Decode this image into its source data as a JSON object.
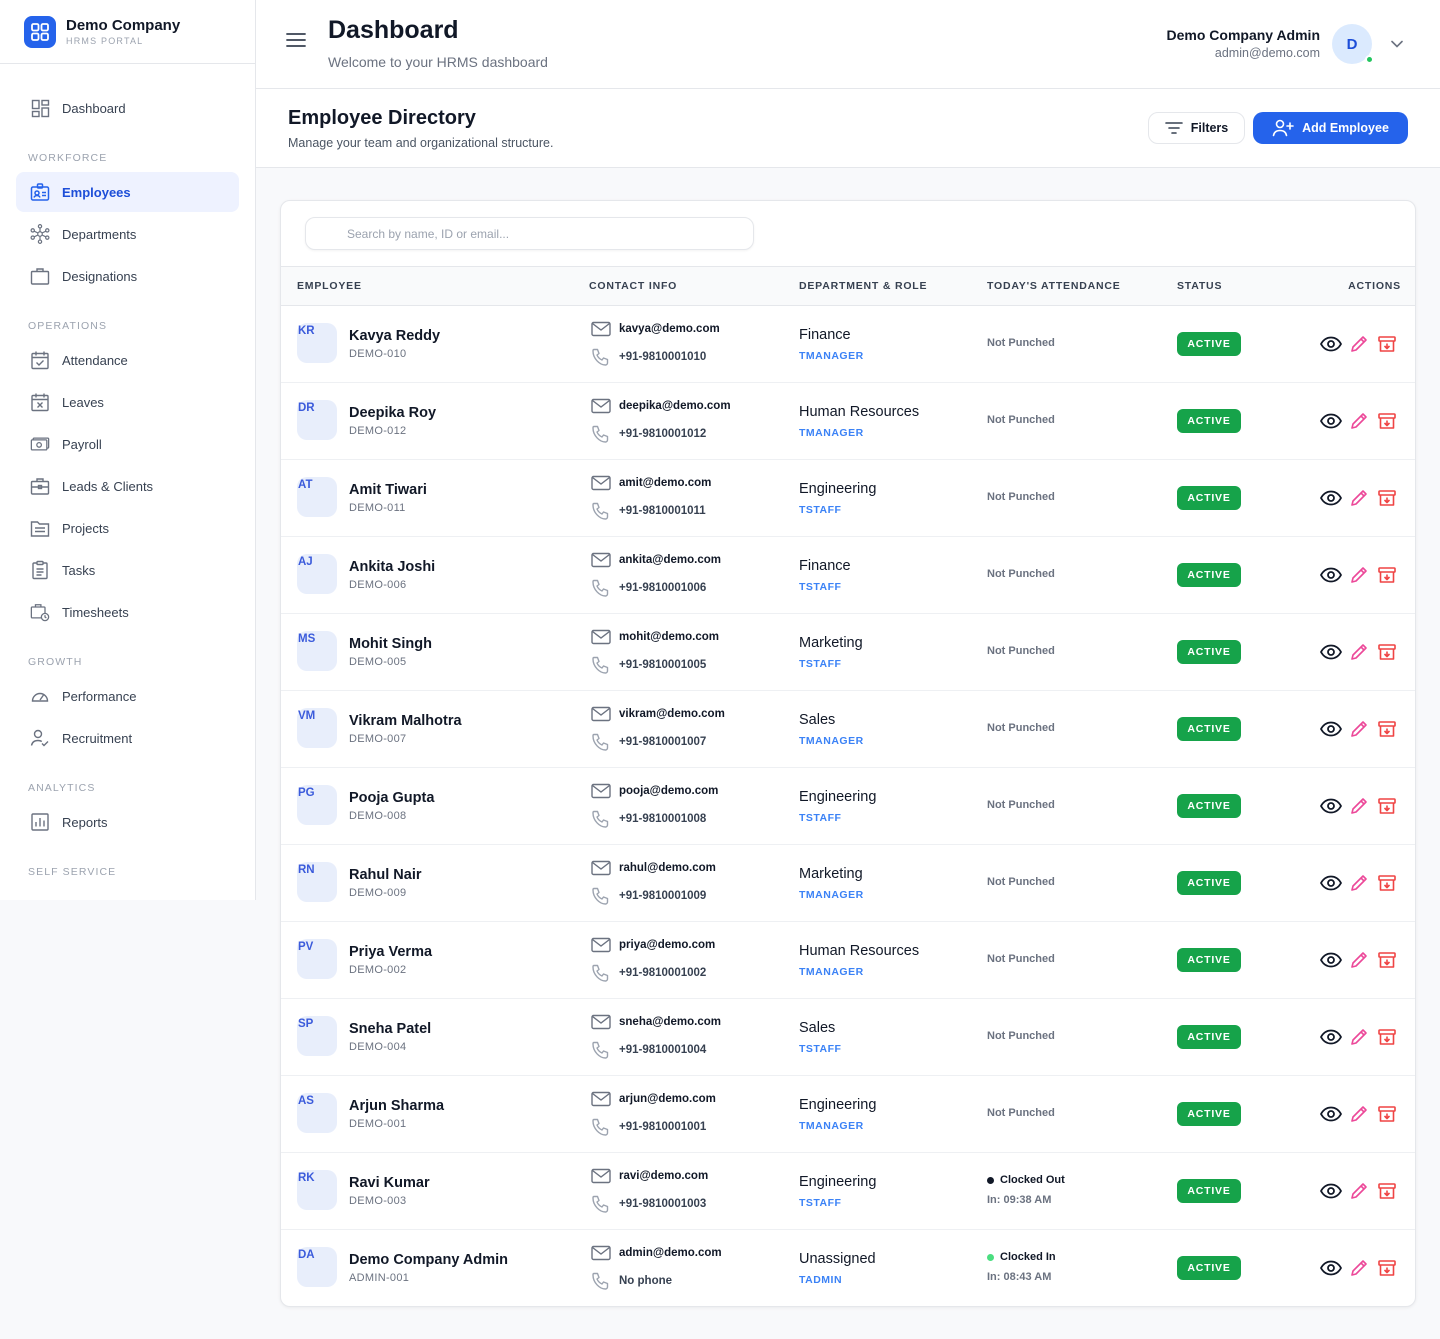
{
  "brand": {
    "name": "Demo Company",
    "sub": "HRMS PORTAL"
  },
  "nav": {
    "dashboard": "Dashboard",
    "sections": {
      "workforce": "WORKFORCE",
      "operations": "OPERATIONS",
      "growth": "GROWTH",
      "analytics": "ANALYTICS",
      "self_service": "SELF SERVICE"
    },
    "items": {
      "employees": "Employees",
      "departments": "Departments",
      "designations": "Designations",
      "attendance": "Attendance",
      "leaves": "Leaves",
      "payroll": "Payroll",
      "leads": "Leads & Clients",
      "projects": "Projects",
      "tasks": "Tasks",
      "timesheets": "Timesheets",
      "performance": "Performance",
      "recruitment": "Recruitment",
      "reports": "Reports"
    },
    "active": "employees"
  },
  "header": {
    "title": "Dashboard",
    "subtitle": "Welcome to your HRMS dashboard",
    "user_name": "Demo Company Admin",
    "user_email": "admin@demo.com",
    "avatar_initial": "D"
  },
  "directory": {
    "title": "Employee Directory",
    "subtitle": "Manage your team and organizational structure.",
    "filters_label": "Filters",
    "add_label": "Add Employee",
    "search_placeholder": "Search by name, ID or email...",
    "columns": {
      "employee": "EMPLOYEE",
      "contact": "CONTACT INFO",
      "dept_role": "DEPARTMENT & ROLE",
      "attendance": "TODAY'S ATTENDANCE",
      "status": "STATUS",
      "actions": "ACTIONS"
    }
  },
  "colors": {
    "accent": "#2563eb",
    "active_status": "#16a34a",
    "edit_icon": "#ec4899",
    "archive_icon": "#ef4444",
    "clocked_out_dot": "#111827",
    "clocked_in_dot": "#4ade80"
  },
  "employees": [
    {
      "initials": "KR",
      "name": "Kavya Reddy",
      "id": "DEMO-010",
      "email": "kavya@demo.com",
      "phone": "+91-9810001010",
      "dept": "Finance",
      "role": "TMANAGER",
      "attendance": "Not Punched",
      "attendance_time": "",
      "status": "ACTIVE"
    },
    {
      "initials": "DR",
      "name": "Deepika Roy",
      "id": "DEMO-012",
      "email": "deepika@demo.com",
      "phone": "+91-9810001012",
      "dept": "Human Resources",
      "role": "TMANAGER",
      "attendance": "Not Punched",
      "attendance_time": "",
      "status": "ACTIVE"
    },
    {
      "initials": "AT",
      "name": "Amit Tiwari",
      "id": "DEMO-011",
      "email": "amit@demo.com",
      "phone": "+91-9810001011",
      "dept": "Engineering",
      "role": "TSTAFF",
      "attendance": "Not Punched",
      "attendance_time": "",
      "status": "ACTIVE"
    },
    {
      "initials": "AJ",
      "name": "Ankita Joshi",
      "id": "DEMO-006",
      "email": "ankita@demo.com",
      "phone": "+91-9810001006",
      "dept": "Finance",
      "role": "TSTAFF",
      "attendance": "Not Punched",
      "attendance_time": "",
      "status": "ACTIVE"
    },
    {
      "initials": "MS",
      "name": "Mohit Singh",
      "id": "DEMO-005",
      "email": "mohit@demo.com",
      "phone": "+91-9810001005",
      "dept": "Marketing",
      "role": "TSTAFF",
      "attendance": "Not Punched",
      "attendance_time": "",
      "status": "ACTIVE"
    },
    {
      "initials": "VM",
      "name": "Vikram Malhotra",
      "id": "DEMO-007",
      "email": "vikram@demo.com",
      "phone": "+91-9810001007",
      "dept": "Sales",
      "role": "TMANAGER",
      "attendance": "Not Punched",
      "attendance_time": "",
      "status": "ACTIVE"
    },
    {
      "initials": "PG",
      "name": "Pooja Gupta",
      "id": "DEMO-008",
      "email": "pooja@demo.com",
      "phone": "+91-9810001008",
      "dept": "Engineering",
      "role": "TSTAFF",
      "attendance": "Not Punched",
      "attendance_time": "",
      "status": "ACTIVE"
    },
    {
      "initials": "RN",
      "name": "Rahul Nair",
      "id": "DEMO-009",
      "email": "rahul@demo.com",
      "phone": "+91-9810001009",
      "dept": "Marketing",
      "role": "TMANAGER",
      "attendance": "Not Punched",
      "attendance_time": "",
      "status": "ACTIVE"
    },
    {
      "initials": "PV",
      "name": "Priya Verma",
      "id": "DEMO-002",
      "email": "priya@demo.com",
      "phone": "+91-9810001002",
      "dept": "Human Resources",
      "role": "TMANAGER",
      "attendance": "Not Punched",
      "attendance_time": "",
      "status": "ACTIVE"
    },
    {
      "initials": "SP",
      "name": "Sneha Patel",
      "id": "DEMO-004",
      "email": "sneha@demo.com",
      "phone": "+91-9810001004",
      "dept": "Sales",
      "role": "TSTAFF",
      "attendance": "Not Punched",
      "attendance_time": "",
      "status": "ACTIVE"
    },
    {
      "initials": "AS",
      "name": "Arjun Sharma",
      "id": "DEMO-001",
      "email": "arjun@demo.com",
      "phone": "+91-9810001001",
      "dept": "Engineering",
      "role": "TMANAGER",
      "attendance": "Not Punched",
      "attendance_time": "",
      "status": "ACTIVE"
    },
    {
      "initials": "RK",
      "name": "Ravi Kumar",
      "id": "DEMO-003",
      "email": "ravi@demo.com",
      "phone": "+91-9810001003",
      "dept": "Engineering",
      "role": "TSTAFF",
      "attendance": "Clocked Out",
      "attendance_time": "In: 09:38 AM",
      "status": "ACTIVE"
    },
    {
      "initials": "DA",
      "name": "Demo Company Admin",
      "id": "ADMIN-001",
      "email": "admin@demo.com",
      "phone": "No phone",
      "dept": "Unassigned",
      "role": "TADMIN",
      "attendance": "Clocked In",
      "attendance_time": "In: 08:43 AM",
      "status": "ACTIVE"
    }
  ]
}
